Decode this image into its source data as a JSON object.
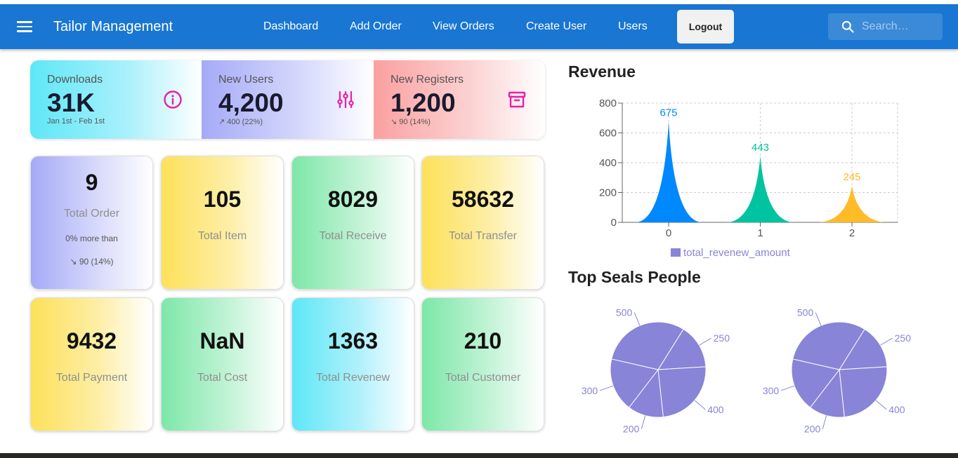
{
  "app": {
    "title": "Tailor Management"
  },
  "nav": [
    {
      "label": "Dashboard"
    },
    {
      "label": "Add Order"
    },
    {
      "label": "View Orders"
    },
    {
      "label": "Create User"
    },
    {
      "label": "Users"
    }
  ],
  "logout_label": "Logout",
  "search": {
    "placeholder": "Search…",
    "value": ""
  },
  "stats": [
    {
      "label": "Downloads",
      "value": "31K",
      "sub": "Jan 1st - Feb 1st",
      "icon": "info-icon"
    },
    {
      "label": "New Users",
      "value": "4,200",
      "sub": "↗ 400 (22%)",
      "icon": "sliders-icon"
    },
    {
      "label": "New Registers",
      "value": "1,200",
      "sub": "↘ 90 (14%)",
      "icon": "archive-icon"
    }
  ],
  "tiles": [
    {
      "value": "9",
      "label": "Total Order",
      "sub1": "0% more than",
      "sub2": "↘ 90 (14%)"
    },
    {
      "value": "105",
      "label": "Total Item"
    },
    {
      "value": "8029",
      "label": "Total Receive"
    },
    {
      "value": "58632",
      "label": "Total Transfer"
    },
    {
      "value": "9432",
      "label": "Total Payment"
    },
    {
      "value": "NaN",
      "label": "Total Cost"
    },
    {
      "value": "1363",
      "label": "Total Revenew"
    },
    {
      "value": "210",
      "label": "Total Customer"
    }
  ],
  "colors": {
    "appbar": "#1976d2",
    "accent_magenta": "#e91eaa",
    "series": "#8884d8"
  },
  "revenue_title": "Revenue",
  "top_seals_title": "Top Seals People",
  "chart_data": [
    {
      "type": "area",
      "title": "Revenue",
      "x": [
        0,
        1,
        2
      ],
      "series": [
        {
          "name": "total_revenew_amount",
          "values": [
            675,
            443,
            245
          ],
          "colors": [
            "#0088fe",
            "#00c49f",
            "#ffbb28"
          ]
        }
      ],
      "ylim": [
        0,
        800
      ],
      "yticks": [
        0,
        200,
        400,
        600,
        800
      ],
      "xticks": [
        "0",
        "1",
        "2"
      ],
      "grid": true,
      "legend": "bottom"
    },
    {
      "type": "pie",
      "labels": [
        "250",
        "400",
        "200",
        "300",
        "500"
      ],
      "values": [
        250,
        400,
        200,
        300,
        500
      ],
      "color": "#8884d8"
    },
    {
      "type": "pie",
      "labels": [
        "250",
        "400",
        "200",
        "300",
        "500"
      ],
      "values": [
        250,
        400,
        200,
        300,
        500
      ],
      "color": "#8884d8"
    }
  ]
}
